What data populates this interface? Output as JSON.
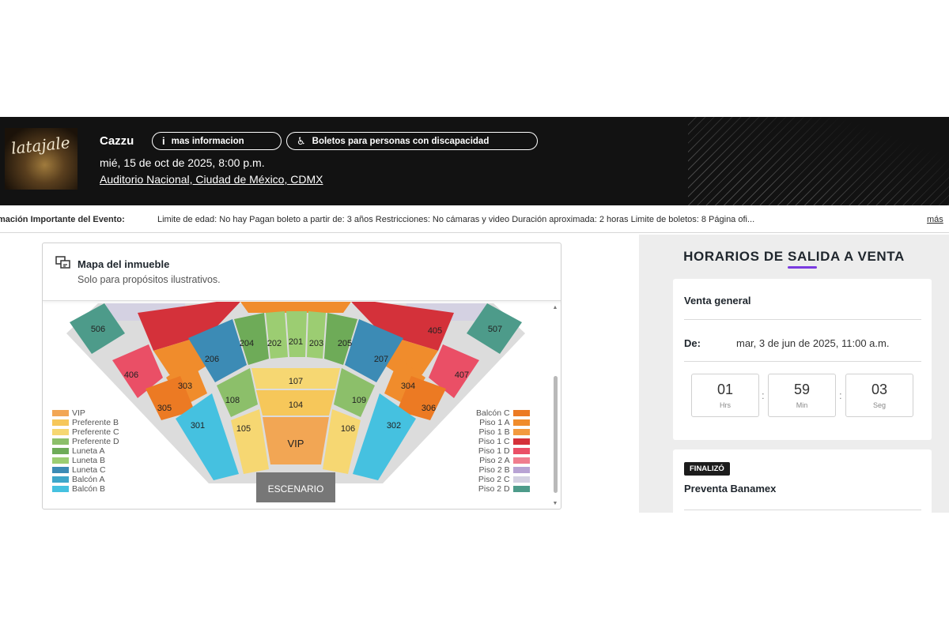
{
  "event": {
    "poster_title": "latajale",
    "name": "Cazzu",
    "info_button": "mas informacion",
    "info_icon": "info-icon",
    "accessibility_button": "Boletos para personas con discapacidad",
    "accessibility_icon": "wheelchair-icon",
    "date": "mié, 15 de oct de 2025, 8:00 p.m.",
    "venue": "Auditorio Nacional, Ciudad de México, CDMX"
  },
  "info_bar": {
    "label": "mación Importante del Evento:",
    "text": "Limite de edad: No hay Pagan boleto a partir de: 3 años Restricciones: No cámaras y video Duración aproximada: 2 horas Limite de boletos: 8 Página ofi...",
    "more": "más"
  },
  "map": {
    "title": "Mapa del inmueble",
    "subtitle": "Solo para propósitos ilustrativos.",
    "stage_label": "ESCENARIO",
    "sections": [
      "506",
      "405",
      "406",
      "303",
      "305",
      "206",
      "204",
      "202",
      "201",
      "203",
      "205",
      "207",
      "304",
      "306",
      "407",
      "507",
      "108",
      "107",
      "104",
      "109",
      "105",
      "106",
      "301",
      "302",
      "VIP"
    ],
    "legend_left": [
      {
        "label": "VIP",
        "color": "#f2a654"
      },
      {
        "label": "Preferente B",
        "color": "#f6c75a"
      },
      {
        "label": "Preferente C",
        "color": "#f6d772"
      },
      {
        "label": "Preferente D",
        "color": "#8cbf6a"
      },
      {
        "label": "Luneta A",
        "color": "#6eab58"
      },
      {
        "label": "Luneta B",
        "color": "#9ccd72"
      },
      {
        "label": "Luneta C",
        "color": "#3c8bb5"
      },
      {
        "label": "Balcón A",
        "color": "#3ea6c9"
      },
      {
        "label": "Balcón B",
        "color": "#45c1e0"
      }
    ],
    "legend_right": [
      {
        "label": "Balcón C",
        "color": "#ec7a23"
      },
      {
        "label": "Piso 1 A",
        "color": "#f08c2c"
      },
      {
        "label": "Piso 1 B",
        "color": "#f39a3f"
      },
      {
        "label": "Piso 1 C",
        "color": "#d4313a"
      },
      {
        "label": "Piso 1 D",
        "color": "#ea4f66"
      },
      {
        "label": "Piso 2 A",
        "color": "#f07d8e"
      },
      {
        "label": "Piso 2 B",
        "color": "#b8a3d4"
      },
      {
        "label": "Piso 2 C",
        "color": "#d4d1e2"
      },
      {
        "label": "Piso 2 D",
        "color": "#4d9b8a"
      }
    ]
  },
  "sales": {
    "heading": "HORARIOS DE SALIDA A VENTA",
    "general": {
      "name": "Venta general",
      "from_label": "De:",
      "from_value": "mar, 3 de jun de 2025, 11:00 a.m.",
      "countdown": {
        "hours": "01",
        "hours_label": "Hrs",
        "minutes": "59",
        "minutes_label": "Min",
        "seconds": "03",
        "seconds_label": "Seg"
      }
    },
    "presale": {
      "badge": "FINALIZÓ",
      "name": "Preventa Banamex"
    }
  }
}
